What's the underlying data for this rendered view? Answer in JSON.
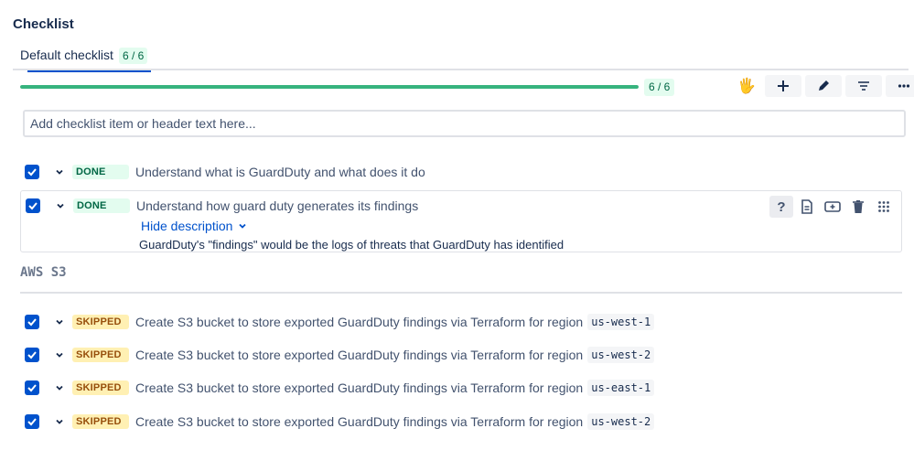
{
  "panel": {
    "title": "Checklist"
  },
  "tab": {
    "label": "Default checklist",
    "count": "6 / 6"
  },
  "progress": {
    "fraction": 1.0,
    "label": "6 / 6",
    "color": "#36b37e"
  },
  "toolbar": {
    "icons": [
      "raised-hand-icon",
      "plus-icon",
      "pencil-icon",
      "filter-icon",
      "more-icon"
    ]
  },
  "add_input": {
    "placeholder": "Add checklist item or header text here..."
  },
  "items": [
    {
      "checked": true,
      "status": "DONE",
      "text": "Understand what is GuardDuty and what does it do"
    },
    {
      "checked": true,
      "status": "DONE",
      "text": "Understand how guard duty generates its findings",
      "desc_toggle": "Hide description",
      "description": "GuardDuty's \"findings\" would be the logs of threats that GuardDuty has identified",
      "actions": [
        "help-icon",
        "document-icon",
        "add-card-icon",
        "trash-icon",
        "drag-handle-icon"
      ]
    }
  ],
  "section": {
    "title": "AWS S3"
  },
  "s3_items": [
    {
      "checked": true,
      "status": "SKIPPED",
      "text": "Create S3 bucket to store exported GuardDuty findings via Terraform for region",
      "code": "us-west-1"
    },
    {
      "checked": true,
      "status": "SKIPPED",
      "text": "Create S3 bucket to store exported GuardDuty findings via Terraform for region",
      "code": "us-west-2"
    },
    {
      "checked": true,
      "status": "SKIPPED",
      "text": "Create S3 bucket to store exported GuardDuty findings via Terraform for region",
      "code": "us-east-1"
    },
    {
      "checked": true,
      "status": "SKIPPED",
      "text": "Create S3 bucket to store exported GuardDuty findings via Terraform for region",
      "code": "us-west-2"
    }
  ],
  "colors": {
    "accent": "#0052cc",
    "done_bg": "#e3fcef",
    "done_fg": "#006644",
    "skipped_bg": "#fff0b3",
    "skipped_fg": "#974f0c"
  }
}
